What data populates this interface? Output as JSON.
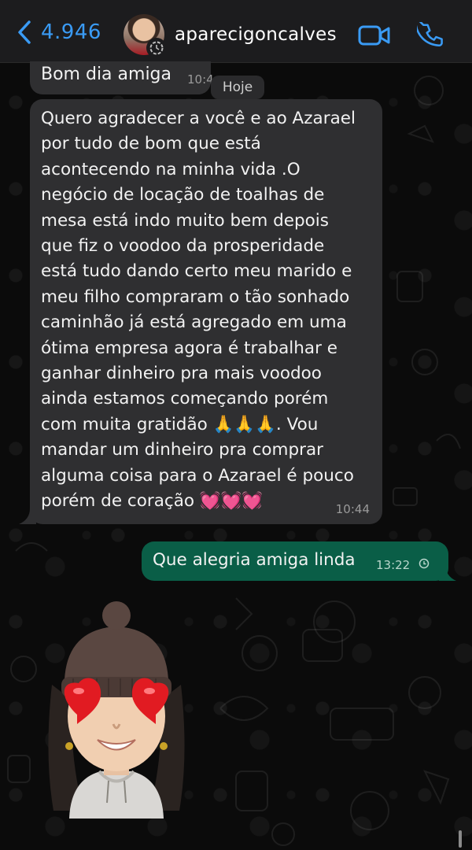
{
  "header": {
    "back_count": "4.946",
    "contact_name": "aparecigoncalves",
    "icons": {
      "back": "chevron-left-icon",
      "video": "video-camera-icon",
      "call": "phone-icon"
    },
    "accent_color": "#3a9bf5"
  },
  "date_divider": "Hoje",
  "messages": [
    {
      "direction": "incoming",
      "text": "Bom dia amiga",
      "time": "10:4"
    },
    {
      "direction": "incoming",
      "text": "Quero agradecer a você e ao Azarael\npor tudo de bom que está\nacontecendo na minha vida .O\nnegócio de locação de toalhas de\nmesa está indo muito bem depois\nque fiz o voodoo da prosperidade\nestá tudo dando certo meu marido e\nmeu filho compraram o tão sonhado\ncaminhão já está agregado em uma\nótima empresa agora é trabalhar e\nganhar dinheiro pra mais voodoo\nainda estamos começando porém\ncom muita gratidão 🙏🙏🙏.  Vou\nmandar um dinheiro pra comprar\nalguma coisa para o Azarael é pouco\nporém de coração 💓💓💓",
      "time": "10:44"
    },
    {
      "direction": "outgoing",
      "text": "Que alegria amiga linda",
      "time": "13:22",
      "status_icon": "clock-pending-icon"
    },
    {
      "direction": "incoming",
      "type": "sticker",
      "sticker_name": "memoji-heart-eyes-sticker"
    }
  ],
  "colors": {
    "incoming_bubble": "#2f2f31",
    "outgoing_bubble": "#0a5e47",
    "header_bg": "#1c1c1e"
  }
}
